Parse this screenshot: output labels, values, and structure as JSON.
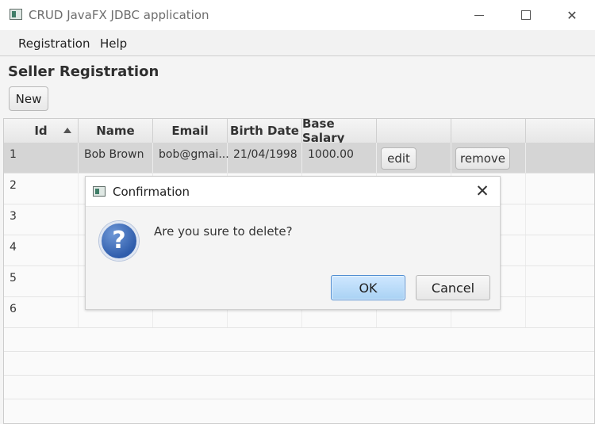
{
  "window": {
    "title": "CRUD JavaFX JDBC application",
    "controls": {
      "minimize": "minimize-icon",
      "maximize": "maximize-icon",
      "close": "close-icon"
    }
  },
  "menubar": {
    "items": [
      "Registration",
      "Help"
    ]
  },
  "page": {
    "title": "Seller Registration",
    "new_label": "New"
  },
  "table": {
    "columns": [
      "Id",
      "Name",
      "Email",
      "Birth Date",
      "Base Salary",
      "",
      ""
    ],
    "sort_indicator": "sort-ascending-icon",
    "rows": [
      {
        "id": "1",
        "name": "Bob Brown",
        "email": "bob@gmai...",
        "birth_date": "21/04/1998",
        "base_salary": "1000.00",
        "edit": "edit",
        "remove": "remove"
      },
      {
        "id": "2"
      },
      {
        "id": "3"
      },
      {
        "id": "4"
      },
      {
        "id": "5"
      },
      {
        "id": "6"
      }
    ]
  },
  "dialog": {
    "title": "Confirmation",
    "message": "Are you sure to delete?",
    "ok_label": "OK",
    "cancel_label": "Cancel",
    "icon": "question-icon"
  },
  "colors": {
    "ok_button_border": "#4d8bd0",
    "ok_button_fill": "#a9d2f4",
    "question_icon": "#2f5dac",
    "selected_row": "#d5d5d5"
  }
}
